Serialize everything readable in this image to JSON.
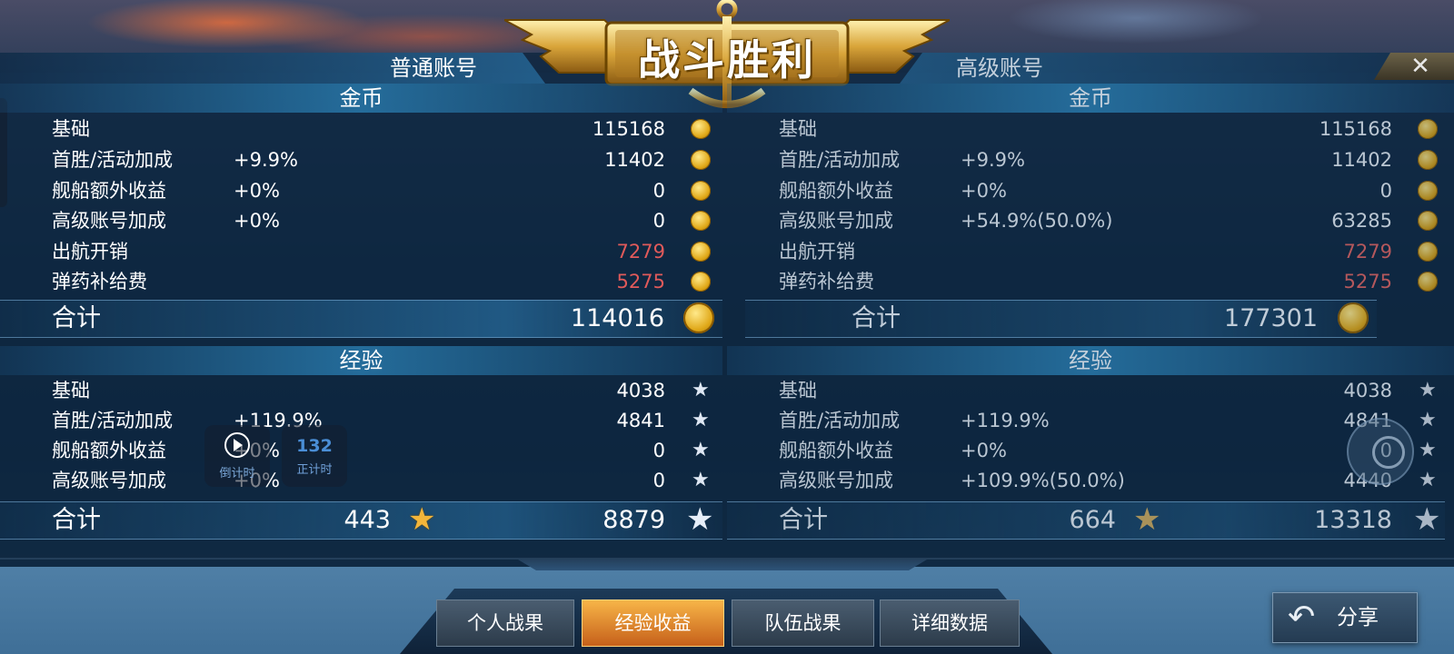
{
  "title": "战斗胜利",
  "tabs": {
    "normal": "普通账号",
    "premium": "高级账号"
  },
  "close_label": "✕",
  "normal": {
    "gold": {
      "header": "金币",
      "rows": [
        {
          "label": "基础",
          "pct": "",
          "value": "115168",
          "negative": false
        },
        {
          "label": "首胜/活动加成",
          "pct": "+9.9%",
          "value": "11402",
          "negative": false
        },
        {
          "label": "舰船额外收益",
          "pct": "+0%",
          "value": "0",
          "negative": false
        },
        {
          "label": "高级账号加成",
          "pct": "+0%",
          "value": "0",
          "negative": false
        },
        {
          "label": "出航开销",
          "pct": "",
          "value": "7279",
          "negative": true
        },
        {
          "label": "弹药补给费",
          "pct": "",
          "value": "5275",
          "negative": true
        }
      ],
      "total_label": "合计",
      "total": "114016"
    },
    "exp": {
      "header": "经验",
      "rows": [
        {
          "label": "基础",
          "pct": "",
          "value": "4038"
        },
        {
          "label": "首胜/活动加成",
          "pct": "+119.9%",
          "value": "4841"
        },
        {
          "label": "舰船额外收益",
          "pct": "+0%",
          "value": "0"
        },
        {
          "label": "高级账号加成",
          "pct": "+0%",
          "value": "0"
        }
      ],
      "total_label": "合计",
      "captain_exp": "443",
      "total": "8879"
    }
  },
  "premium": {
    "gold": {
      "header": "金币",
      "rows": [
        {
          "label": "基础",
          "pct": "",
          "value": "115168",
          "negative": false
        },
        {
          "label": "首胜/活动加成",
          "pct": "+9.9%",
          "value": "11402",
          "negative": false
        },
        {
          "label": "舰船额外收益",
          "pct": "+0%",
          "value": "0",
          "negative": false
        },
        {
          "label": "高级账号加成",
          "pct": "+54.9%(50.0%)",
          "value": "63285",
          "negative": false
        },
        {
          "label": "出航开销",
          "pct": "",
          "value": "7279",
          "negative": true
        },
        {
          "label": "弹药补给费",
          "pct": "",
          "value": "5275",
          "negative": true
        }
      ],
      "total_label": "合计",
      "total": "177301"
    },
    "exp": {
      "header": "经验",
      "rows": [
        {
          "label": "基础",
          "pct": "",
          "value": "4038"
        },
        {
          "label": "首胜/活动加成",
          "pct": "+119.9%",
          "value": "4841"
        },
        {
          "label": "舰船额外收益",
          "pct": "+0%",
          "value": "0"
        },
        {
          "label": "高级账号加成",
          "pct": "+109.9%(50.0%)",
          "value": "4440"
        }
      ],
      "total_label": "合计",
      "captain_exp": "664",
      "total": "13318"
    }
  },
  "overlay": {
    "countdown_label": "倒计时",
    "countup_value": "132",
    "countup_label": "正计时"
  },
  "nav": {
    "tabs": [
      "个人战果",
      "经验收益",
      "队伍战果",
      "详细数据"
    ],
    "active": "经验收益"
  },
  "share_label": "分享",
  "colors": {
    "negative": "#e05a5a",
    "active_tab": "#f0a040",
    "gold": "#e0a818"
  }
}
